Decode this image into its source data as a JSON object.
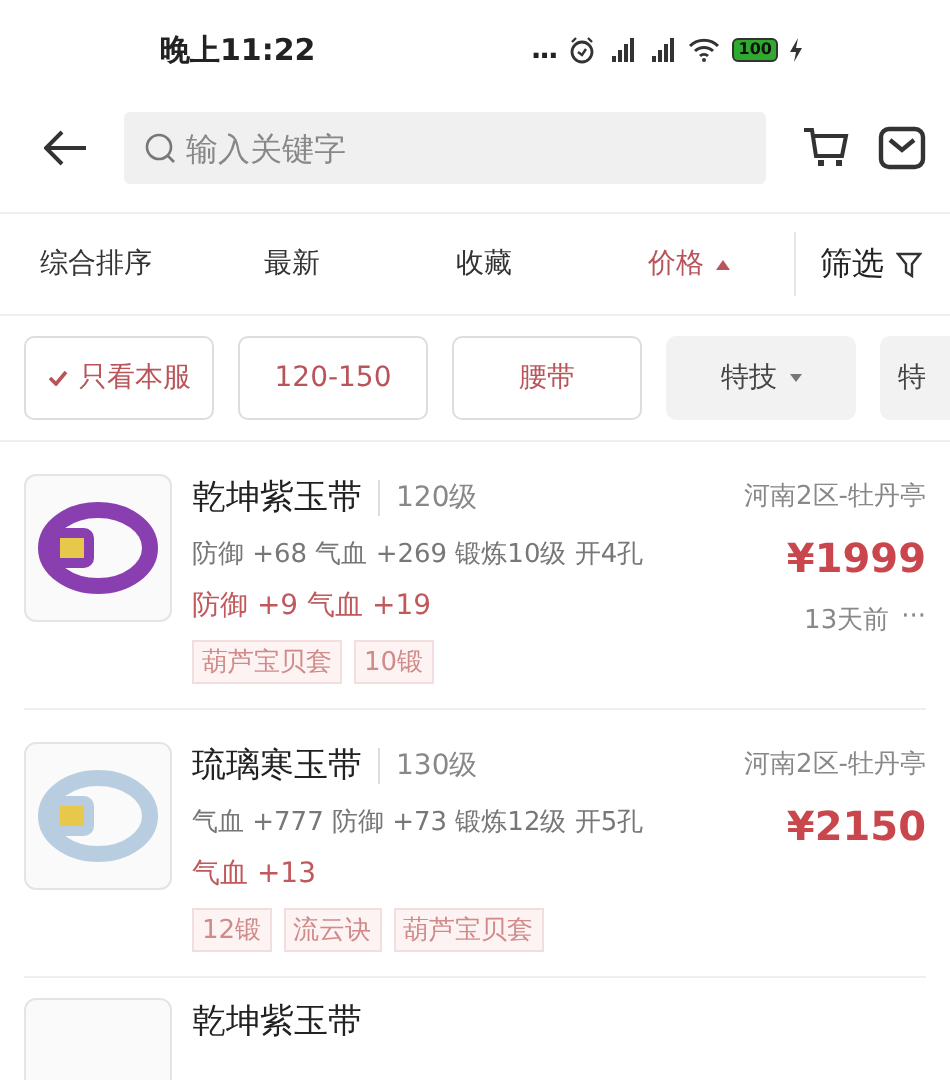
{
  "status_bar": {
    "time": "晚上11:22",
    "dots": "...",
    "battery": "100"
  },
  "search": {
    "placeholder": "输入关键字"
  },
  "sort_tabs": [
    {
      "label": "综合排序",
      "selected": false,
      "arrow": false
    },
    {
      "label": "最新",
      "selected": false,
      "arrow": false
    },
    {
      "label": "收藏",
      "selected": false,
      "arrow": false
    },
    {
      "label": "价格",
      "selected": true,
      "arrow": true
    }
  ],
  "filter_button": {
    "label": "筛选"
  },
  "chips": [
    {
      "label": "只看本服",
      "selected": true,
      "check": true,
      "caret": false
    },
    {
      "label": "120-150",
      "selected": true,
      "check": false,
      "caret": false
    },
    {
      "label": "腰带",
      "selected": true,
      "check": false,
      "caret": false
    },
    {
      "label": "特技",
      "selected": false,
      "check": false,
      "caret": true
    },
    {
      "label": "特",
      "selected": false,
      "check": false,
      "caret": false
    }
  ],
  "listings": [
    {
      "name": "乾坤紫玉带",
      "level": "120级",
      "server": "河南2区-牡丹亭",
      "price": "¥1999",
      "stats": "防御 +68 气血 +269 锻炼10级 开4孔",
      "bonus": "防御 +9 气血 +19",
      "tags": [
        "葫芦宝贝套",
        "10锻"
      ],
      "time": "13天前",
      "more": "···",
      "color": "#8a3fb0"
    },
    {
      "name": "琉璃寒玉带",
      "level": "130级",
      "server": "河南2区-牡丹亭",
      "price": "¥2150",
      "stats": "气血 +777 防御 +73 锻炼12级 开5孔",
      "bonus": "气血 +13",
      "tags": [
        "12锻",
        "流云诀",
        "葫芦宝贝套"
      ],
      "color": "#b8cde0"
    },
    {
      "name": "乾坤紫玉带"
    }
  ]
}
